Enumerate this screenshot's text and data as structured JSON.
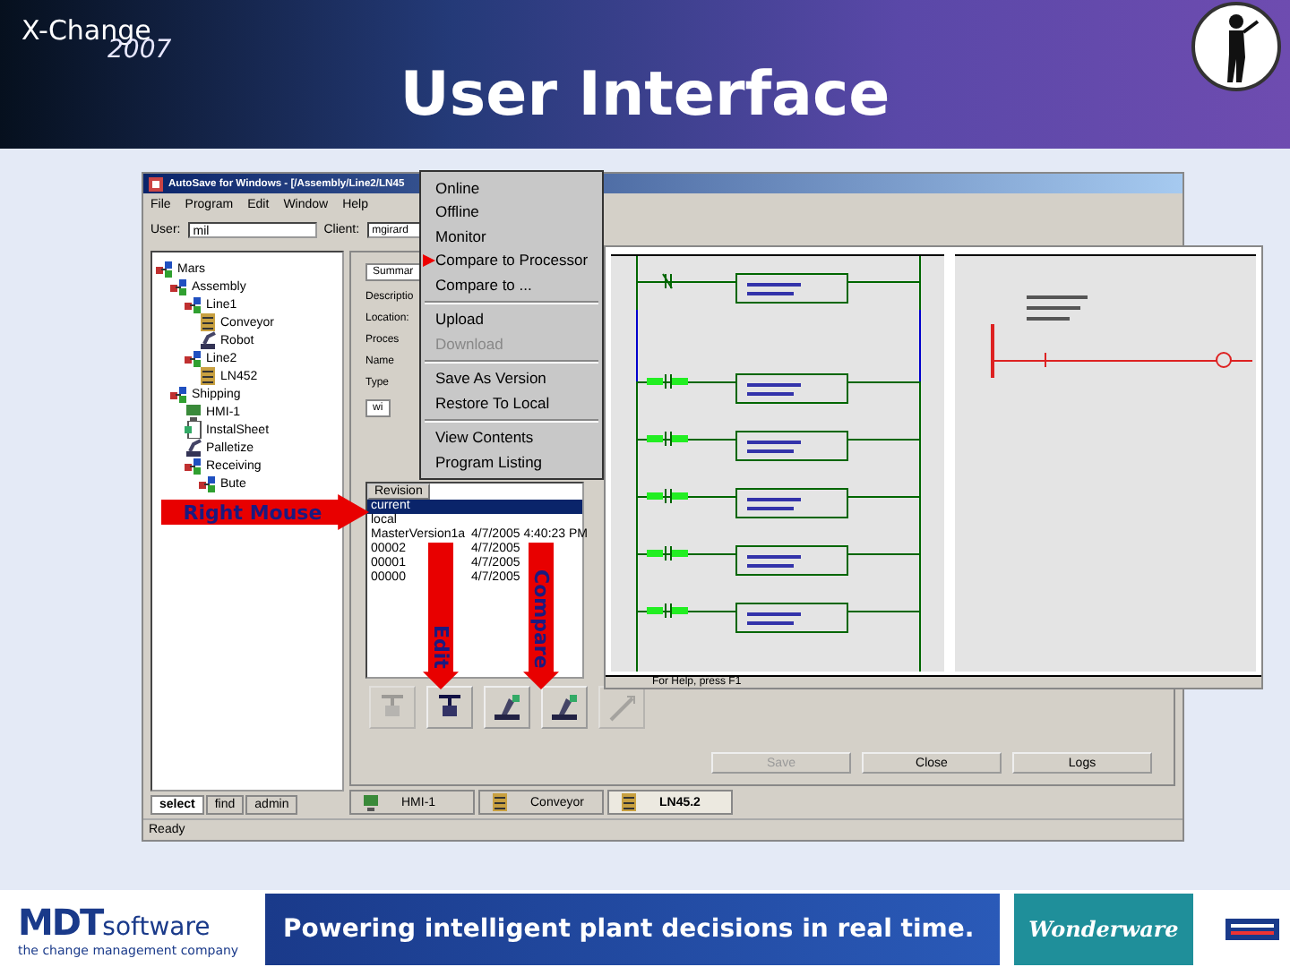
{
  "slide": {
    "event_name": "X-Change",
    "event_year": "2007",
    "title": "User Interface"
  },
  "app": {
    "title": "AutoSave for Windows - [/Assembly/Line2/LN45",
    "menu": [
      "File",
      "Program",
      "Edit",
      "Window",
      "Help"
    ],
    "user_label": "User:",
    "user_value": "mil",
    "client_label": "Client:",
    "client_value": "mgirard",
    "tree": [
      {
        "label": "Mars",
        "kind": "folder",
        "children": [
          {
            "label": "Assembly",
            "kind": "folder",
            "children": [
              {
                "label": "Line1",
                "kind": "folder",
                "children": [
                  {
                    "label": "Conveyor",
                    "kind": "device"
                  },
                  {
                    "label": "Robot",
                    "kind": "robot"
                  }
                ]
              },
              {
                "label": "Line2",
                "kind": "folder",
                "children": [
                  {
                    "label": "LN452",
                    "kind": "device"
                  }
                ]
              }
            ]
          },
          {
            "label": "Shipping",
            "kind": "folder",
            "children": [
              {
                "label": "HMI-1",
                "kind": "hmi"
              },
              {
                "label": "InstalSheet",
                "kind": "doc"
              },
              {
                "label": "Palletize",
                "kind": "robot"
              },
              {
                "label": "Receiving",
                "kind": "folder",
                "children": [
                  {
                    "label": "Bute",
                    "kind": "folder"
                  }
                ]
              }
            ]
          }
        ]
      }
    ],
    "left_tabs": [
      {
        "label": "select",
        "selected": true
      },
      {
        "label": "find",
        "selected": false
      },
      {
        "label": "admin",
        "selected": false
      }
    ],
    "summary": {
      "tab": "Summar",
      "description_label": "Descriptio",
      "location_label": "Location:",
      "group_label": "Proces",
      "name_label": "Name",
      "type_label": "Type",
      "list_header": "wi"
    },
    "revisions": {
      "header": "Revision",
      "rows": [
        {
          "name": "current",
          "date": "",
          "selected": true
        },
        {
          "name": "local",
          "date": "",
          "selected": false
        },
        {
          "name": "MasterVersion1a",
          "date": "4/7/2005 4:40:23 PM",
          "selected": false
        },
        {
          "name": "00002",
          "date": "4/7/2005",
          "selected": false
        },
        {
          "name": "00001",
          "date": "4/7/2005",
          "selected": false
        },
        {
          "name": "00000",
          "date": "4/7/2005",
          "selected": false
        }
      ]
    },
    "tool_buttons": [
      {
        "kind": "checkout",
        "disabled": true
      },
      {
        "kind": "checkin",
        "disabled": false
      },
      {
        "kind": "compare",
        "disabled": false
      },
      {
        "kind": "compare",
        "disabled": false
      },
      {
        "kind": "edit",
        "disabled": true
      }
    ],
    "dialog_buttons": [
      {
        "label": "Save",
        "disabled": true
      },
      {
        "label": "Close",
        "disabled": false
      },
      {
        "label": "Logs",
        "disabled": false
      }
    ],
    "doc_tabs": [
      {
        "label": "HMI-1",
        "kind": "hmi",
        "selected": false
      },
      {
        "label": "Conveyor",
        "kind": "device",
        "selected": false
      },
      {
        "label": "LN45.2",
        "kind": "device",
        "selected": true
      }
    ],
    "status": "Ready"
  },
  "context_menu": {
    "groups": [
      [
        {
          "label": "Online",
          "disabled": false,
          "pointed": false
        },
        {
          "label": "Offline",
          "disabled": false,
          "pointed": false
        },
        {
          "label": "Monitor",
          "disabled": false,
          "pointed": false
        },
        {
          "label": "Compare to Processor",
          "disabled": false,
          "pointed": true
        },
        {
          "label": "Compare to ...",
          "disabled": false,
          "pointed": false
        }
      ],
      [
        {
          "label": "Upload",
          "disabled": false,
          "pointed": false
        },
        {
          "label": "Download",
          "disabled": true,
          "pointed": false
        }
      ],
      [
        {
          "label": "Save As Version",
          "disabled": false,
          "pointed": false
        },
        {
          "label": "Restore To Local",
          "disabled": false,
          "pointed": false
        }
      ],
      [
        {
          "label": "View Contents",
          "disabled": false,
          "pointed": false
        },
        {
          "label": "Program Listing",
          "disabled": false,
          "pointed": false
        }
      ]
    ]
  },
  "ladder": {
    "status": "For Help, press F1",
    "left_rungs": [
      {
        "energized": false
      },
      {
        "energized": true
      },
      {
        "energized": true
      },
      {
        "energized": true
      },
      {
        "energized": true
      },
      {
        "energized": true
      }
    ],
    "right_rung": {
      "changed": true
    }
  },
  "callouts": [
    {
      "label": "Right Mouse",
      "kind": "right"
    },
    {
      "label": "Edit",
      "kind": "down"
    },
    {
      "label": "Compare",
      "kind": "down"
    }
  ],
  "footer": {
    "company": "MDT",
    "company_suffix": "software",
    "tagline": "the change management company",
    "banner": "Powering intelligent plant decisions in real time.",
    "partner": "Wonderware"
  }
}
